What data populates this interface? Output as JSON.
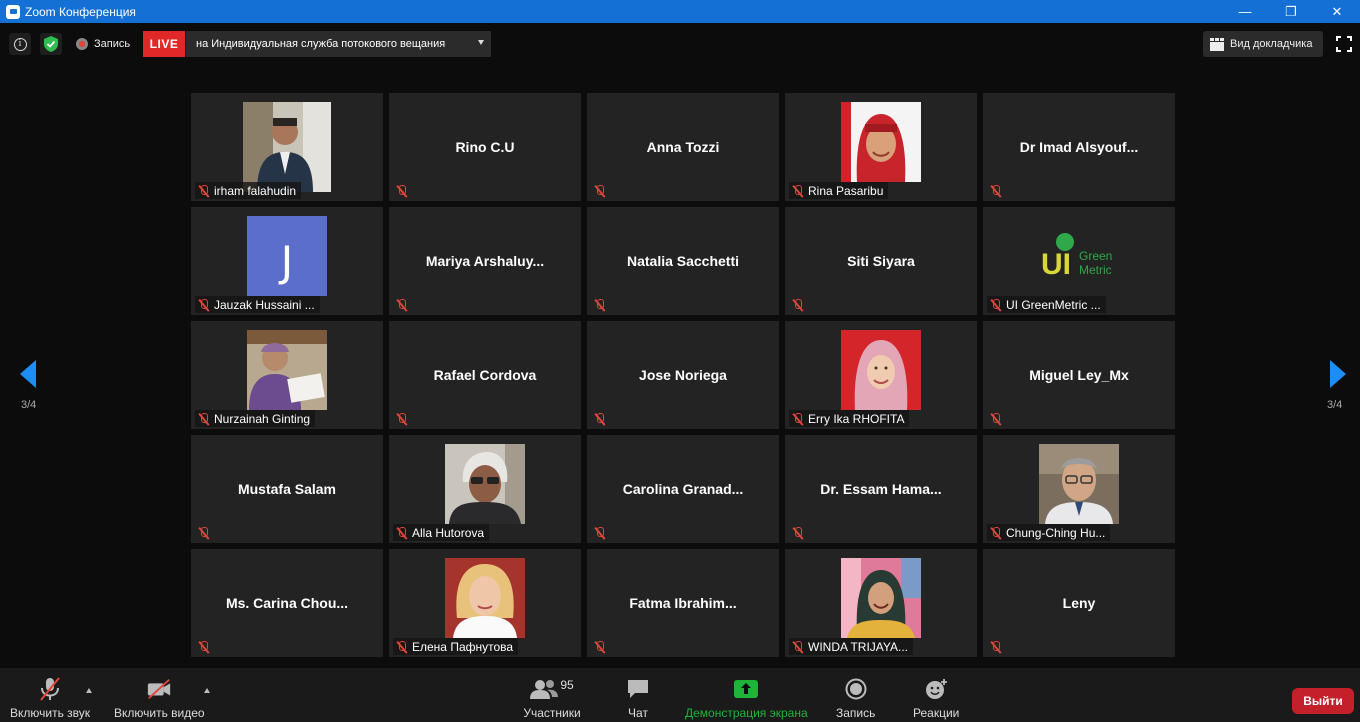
{
  "window": {
    "title": "Zoom Конференция",
    "minimize": "—",
    "restore": "❐",
    "close": "✕"
  },
  "topbar": {
    "info_glyph": "i",
    "recording_label": "Запись",
    "live_label": "LIVE",
    "live_destination": "на Индивидуальная служба потокового вещания",
    "speaker_view_label": "Вид докладчика"
  },
  "participants": [
    {
      "name": "irham falahudin",
      "has_video": true,
      "icon": "photo-man-suit"
    },
    {
      "name": "Rino C.U",
      "has_video": false
    },
    {
      "name": "Anna Tozzi",
      "has_video": false
    },
    {
      "name": "Rina Pasaribu",
      "has_video": true,
      "icon": "photo-woman-red-hijab"
    },
    {
      "name": "Dr Imad Alsyouf...",
      "has_video": false
    },
    {
      "name": "Jauzak Hussaini ...",
      "has_video": true,
      "icon": "avatar-letter",
      "avatar_letter": "J"
    },
    {
      "name": "Mariya  Arshaluy...",
      "has_video": false
    },
    {
      "name": "Natalia Sacchetti",
      "has_video": false
    },
    {
      "name": "Siti Siyara",
      "has_video": false
    },
    {
      "name": "UI GreenMetric ...",
      "has_video": true,
      "icon": "ui-greenmetric-logo",
      "logo_text_main": "UI",
      "logo_text_top": "Green",
      "logo_text_bottom": "Metric"
    },
    {
      "name": "Nurzainah Ginting",
      "has_video": true,
      "icon": "photo-woman-purple"
    },
    {
      "name": "Rafael Cordova",
      "has_video": false
    },
    {
      "name": "Jose Noriega",
      "has_video": false
    },
    {
      "name": "Erry Ika RHOFITA",
      "has_video": true,
      "icon": "photo-woman-pink-hijab"
    },
    {
      "name": "Miguel Ley_Mx",
      "has_video": false
    },
    {
      "name": "Mustafa Salam",
      "has_video": false
    },
    {
      "name": "Alla Hutorova",
      "has_video": true,
      "icon": "photo-woman-glasses"
    },
    {
      "name": "Carolina  Granad...",
      "has_video": false
    },
    {
      "name": "Dr. Essam  Hama...",
      "has_video": false
    },
    {
      "name": "Chung-Ching Hu...",
      "has_video": true,
      "icon": "photo-man-glasses"
    },
    {
      "name": "Ms. Carina  Chou...",
      "has_video": false
    },
    {
      "name": "Елена Пафнутова",
      "has_video": true,
      "icon": "photo-woman-blonde"
    },
    {
      "name": "Fatma  Ibrahim...",
      "has_video": false
    },
    {
      "name": "WINDA TRIJAYA...",
      "has_video": true,
      "icon": "photo-woman-hijab-smile"
    },
    {
      "name": "Leny",
      "has_video": false
    }
  ],
  "navigation": {
    "page_left": "3/4",
    "page_right": "3/4"
  },
  "toolbar": {
    "audio_label": "Включить звук",
    "video_label": "Включить видео",
    "participants_label": "Участники",
    "participants_count": "95",
    "chat_label": "Чат",
    "share_label": "Демонстрация экрана",
    "record_label": "Запись",
    "reactions_label": "Реакции",
    "leave_label": "Выйти"
  },
  "colors": {
    "titlebar": "#1570d6",
    "live": "#e02828",
    "share_green": "#1fb33a",
    "muted_red": "#e0453b",
    "nav_blue": "#1d8ef5",
    "leave_red": "#c3202a"
  }
}
